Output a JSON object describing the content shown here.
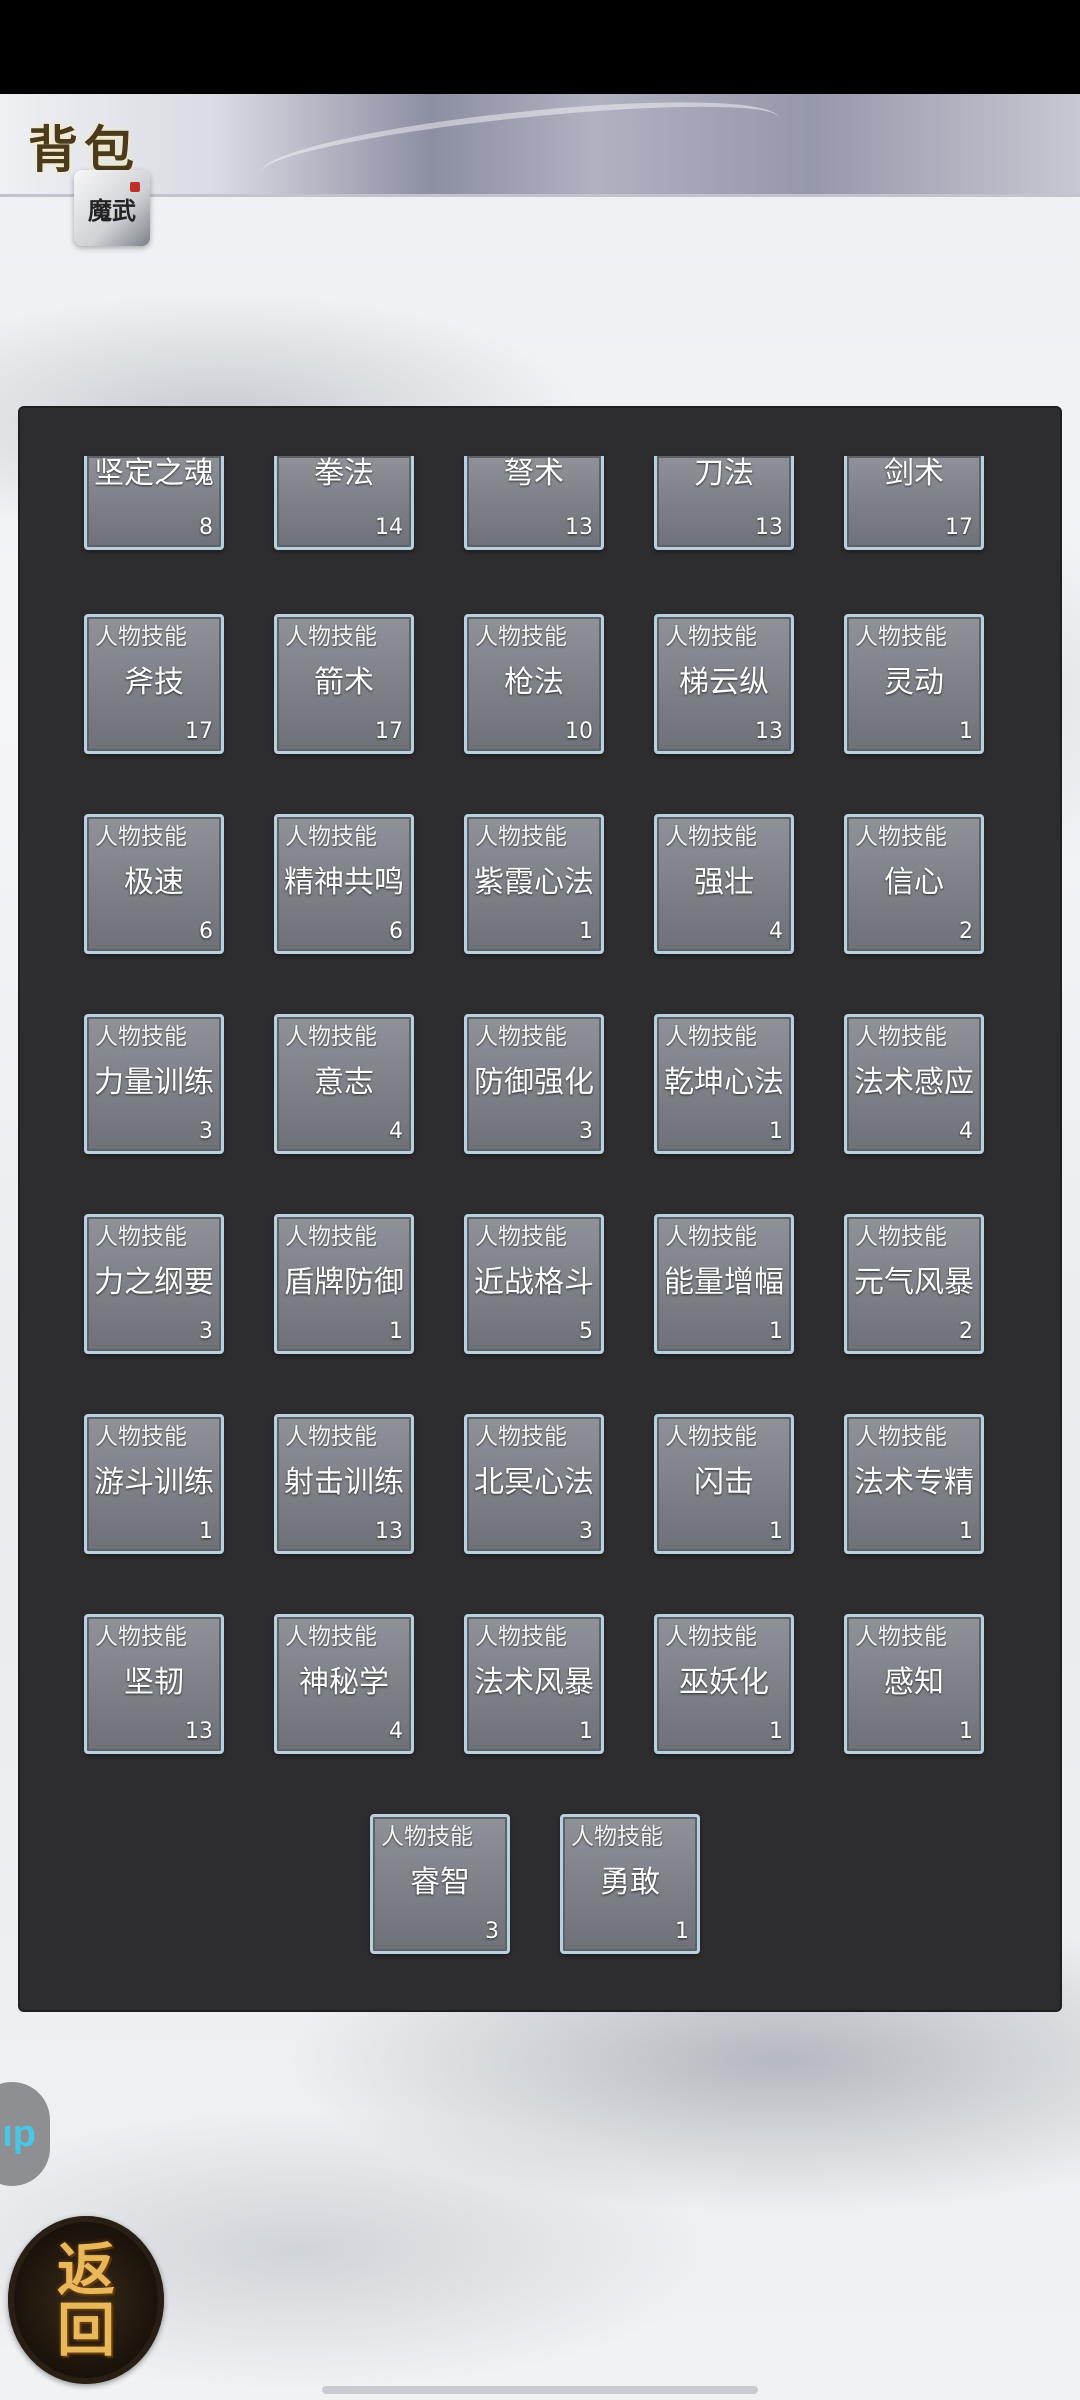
{
  "header": {
    "title": "背包",
    "logo_text": "魔武"
  },
  "skill_type_label": "人物技能",
  "rows": [
    {
      "cut": true,
      "items": [
        {
          "name": "坚定之魂",
          "count": "8"
        },
        {
          "name": "拳法",
          "count": "14"
        },
        {
          "name": "弩术",
          "count": "13"
        },
        {
          "name": "刀法",
          "count": "13"
        },
        {
          "name": "剑术",
          "count": "17"
        }
      ]
    },
    {
      "items": [
        {
          "name": "斧技",
          "count": "17"
        },
        {
          "name": "箭术",
          "count": "17"
        },
        {
          "name": "枪法",
          "count": "10"
        },
        {
          "name": "梯云纵",
          "count": "13"
        },
        {
          "name": "灵动",
          "count": "1"
        }
      ]
    },
    {
      "items": [
        {
          "name": "极速",
          "count": "6"
        },
        {
          "name": "精神共鸣",
          "count": "6"
        },
        {
          "name": "紫霞心法",
          "count": "1"
        },
        {
          "name": "强壮",
          "count": "4"
        },
        {
          "name": "信心",
          "count": "2"
        }
      ]
    },
    {
      "items": [
        {
          "name": "力量训练",
          "count": "3"
        },
        {
          "name": "意志",
          "count": "4"
        },
        {
          "name": "防御强化",
          "count": "3"
        },
        {
          "name": "乾坤心法",
          "count": "1"
        },
        {
          "name": "法术感应",
          "count": "4"
        }
      ]
    },
    {
      "items": [
        {
          "name": "力之纲要",
          "count": "3"
        },
        {
          "name": "盾牌防御",
          "count": "1"
        },
        {
          "name": "近战格斗",
          "count": "5"
        },
        {
          "name": "能量增幅",
          "count": "1"
        },
        {
          "name": "元气风暴",
          "count": "2"
        }
      ]
    },
    {
      "items": [
        {
          "name": "游斗训练",
          "count": "1"
        },
        {
          "name": "射击训练",
          "count": "13"
        },
        {
          "name": "北冥心法",
          "count": "3"
        },
        {
          "name": "闪击",
          "count": "1"
        },
        {
          "name": "法术专精",
          "count": "1"
        }
      ]
    },
    {
      "items": [
        {
          "name": "坚韧",
          "count": "13"
        },
        {
          "name": "神秘学",
          "count": "4"
        },
        {
          "name": "法术风暴",
          "count": "1"
        },
        {
          "name": "巫妖化",
          "count": "1"
        },
        {
          "name": "感知",
          "count": "1"
        }
      ]
    },
    {
      "items": [
        {
          "name": "睿智",
          "count": "3"
        },
        {
          "name": "勇敢",
          "count": "1"
        }
      ]
    }
  ],
  "float_button_text": "ıp",
  "back_button": {
    "line1": "返",
    "line2": "回"
  }
}
